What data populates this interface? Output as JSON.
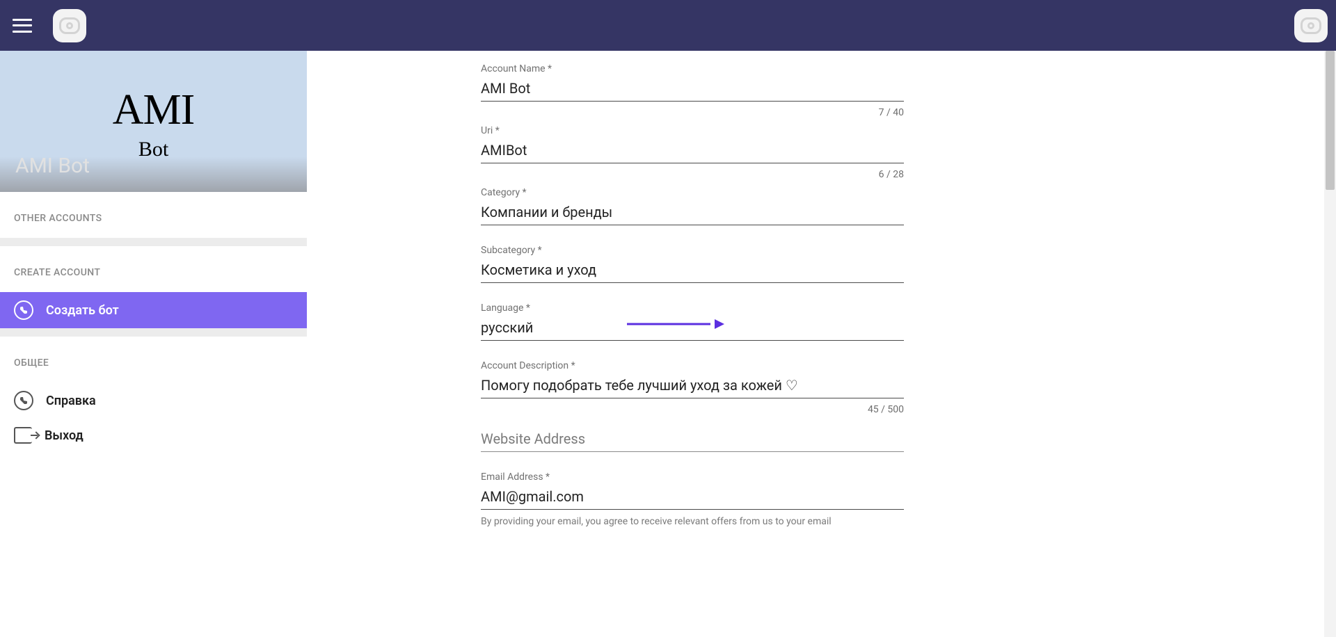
{
  "topbar": {},
  "sidebar": {
    "hero": {
      "title": "AMI",
      "subtitle": "Bot",
      "overlay_label": "AMI Bot"
    },
    "sections": {
      "other_accounts": "OTHER ACCOUNTS",
      "create_account": "CREATE ACCOUNT",
      "general": "ОБЩЕЕ"
    },
    "items": {
      "create_bot": "Создать бот",
      "help": "Справка",
      "logout": "Выход"
    }
  },
  "form": {
    "account_name": {
      "label": "Account Name *",
      "value": "AMI Bot",
      "counter": "7 / 40"
    },
    "uri": {
      "label": "Uri *",
      "value": "AMIBot",
      "counter": "6 / 28"
    },
    "category": {
      "label": "Category *",
      "value": "Компании и бренды"
    },
    "subcategory": {
      "label": "Subcategory *",
      "value": "Косметика и уход"
    },
    "language": {
      "label": "Language *",
      "value": "русский"
    },
    "description": {
      "label": "Account Description *",
      "value": "Помогу подобрать тебе лучший уход за кожей ♡",
      "counter": "45 / 500"
    },
    "website": {
      "placeholder": "Website Address",
      "value": ""
    },
    "email": {
      "label": "Email Address *",
      "value": "AMI@gmail.com",
      "helper": "By providing your email, you agree to receive relevant offers from us to your email"
    }
  }
}
